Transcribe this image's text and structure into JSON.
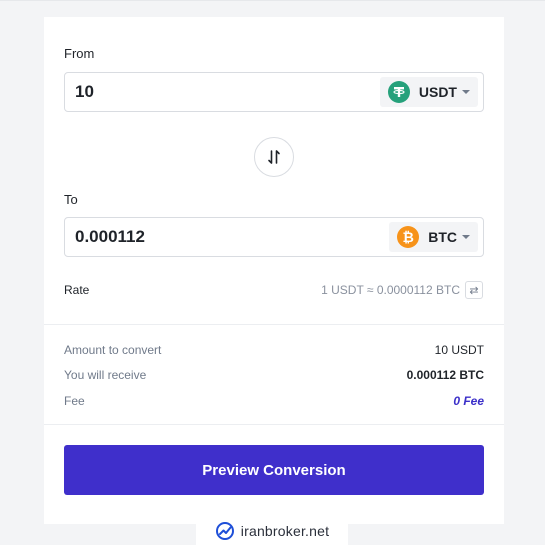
{
  "from": {
    "label": "From",
    "amount": "10",
    "coin": {
      "code": "USDT",
      "icon": "tether-icon",
      "color": "#26a17b",
      "glyph": "₮"
    }
  },
  "to": {
    "label": "To",
    "amount": "0.000112",
    "coin": {
      "code": "BTC",
      "icon": "bitcoin-icon",
      "color": "#f7931a",
      "glyph": "₿"
    }
  },
  "swap_icon": "swap-vertical-icon",
  "rate": {
    "label": "Rate",
    "value": "1 USDT ≈ 0.0000112 BTC",
    "refresh_icon": "swap-horizontal-icon"
  },
  "summary": {
    "amount_to_convert": {
      "label": "Amount to convert",
      "value": "10 USDT"
    },
    "you_will_receive": {
      "label": "You will receive",
      "value": "0.000112 BTC"
    },
    "fee": {
      "label": "Fee",
      "value": "0 Fee"
    }
  },
  "preview_button": {
    "label": "Preview Conversion",
    "color": "#3f2fcb"
  },
  "watermark": {
    "text": "iranbroker.net",
    "icon": "chart-logo-icon"
  }
}
